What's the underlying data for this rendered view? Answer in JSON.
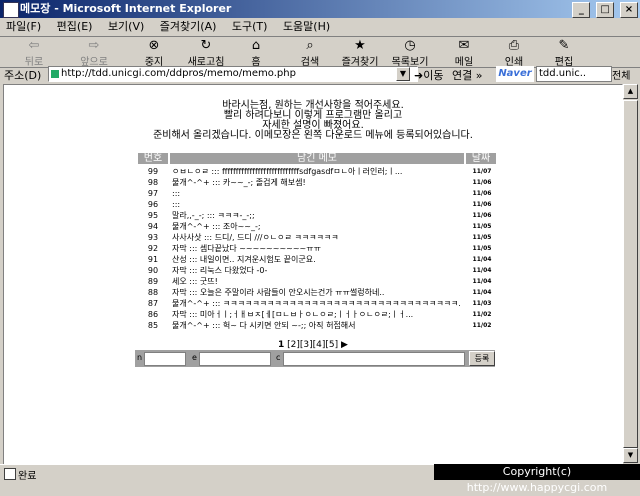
{
  "window": {
    "title": "메모장 - Microsoft Internet Explorer",
    "min_label": "_",
    "max_label": "□",
    "close_label": "×"
  },
  "menu": [
    "파일(F)",
    "편집(E)",
    "보기(V)",
    "즐겨찾기(A)",
    "도구(T)",
    "도움말(H)"
  ],
  "toolbar": {
    "back": "뒤로",
    "forward": "앞으로",
    "stop": "중지",
    "refresh": "새로고침",
    "home": "홈",
    "search": "검색",
    "favorites": "즐겨찾기",
    "history": "목록보기",
    "mail": "메일",
    "print": "인쇄",
    "edit": "편집"
  },
  "address": {
    "label": "주소(D)",
    "url": "http://tdd.unicgi.com/ddpros/memo/memo.php",
    "go": "이동",
    "links": "연결 »",
    "naver": "Naver",
    "naver_input": "tdd.unic..",
    "fullview": "전체"
  },
  "intro": [
    "바라시는점, 원하는 개선사항을 적어주세요.",
    "빨리 하려다보니 이렇게 프로그램만 올리고",
    "자세한 설명이 빠졌어요.",
    "준비해서 올리겠습니다. 이메모장은 왼쪽 다운로드 메뉴에 등록되어있습니다."
  ],
  "table": {
    "headers": [
      "번호",
      "남긴 메모",
      "날짜"
    ],
    "rows": [
      {
        "num": "99",
        "msg": "ㅇㅂㄴㅇㄹ ::: ffffffffffffffffffffffffffffsdfgasdfㅁㄴ아ㅣ러인러;ㅣ...",
        "date": "11/07"
      },
      {
        "num": "98",
        "msg": "물개^-^+ ::: 카~~_-; 졸겁게 해보셈!",
        "date": "11/06"
      },
      {
        "num": "97",
        "msg": ":::",
        "date": "11/06"
      },
      {
        "num": "96",
        "msg": ":::",
        "date": "11/06"
      },
      {
        "num": "95",
        "msg": "말라,,-_-; ::: ㅋㅋㅋ-_-;;",
        "date": "11/06"
      },
      {
        "num": "94",
        "msg": "물개^-^+ ::: 조아~~_-;",
        "date": "11/05"
      },
      {
        "num": "93",
        "msg": "사사사삿 ::: 드디/, 드디 ///ㅇㄴㅇㄹ ㅋㅋㅋㅋㅋㅋ",
        "date": "11/05"
      },
      {
        "num": "92",
        "msg": "자막 ::: 셈다끝났다 ~~~~~~~~~~ㅠㅠ",
        "date": "11/05"
      },
      {
        "num": "91",
        "msg": "산성 ::: 내일이면.. 지겨운시험도 끝이군요.",
        "date": "11/04"
      },
      {
        "num": "90",
        "msg": "자막 ::: 리눅스 다왔었다 -0-",
        "date": "11/04"
      },
      {
        "num": "89",
        "msg": "세오 ::: 굿뜨!",
        "date": "11/04"
      },
      {
        "num": "88",
        "msg": "자막 ::: 오늘은 주말이라 사람들이 안오시는건가 ㅠㅠ썰렁하네..",
        "date": "11/04"
      },
      {
        "num": "87",
        "msg": "물개^-^+ ::: ㅋㅋㅋㅋㅋㅋㅋㅋㅋㅋㅋㅋㅋㅋㅋㅋㅋㅋㅋㅋㅋㅋㅋㅋㅋㅋㅋㅋㅋㅋㅋㅋ..",
        "date": "11/03"
      },
      {
        "num": "86",
        "msg": "자막 ::: 미아ㅓㅣ;ㅓㅐㅂㅈ[ㅔ[ㅁㄴㅂㅏㅇㄴㅇㄹ;ㅣㅓㅏㅇㄴㅇㄹ;ㅣㅓ...",
        "date": "11/02"
      },
      {
        "num": "85",
        "msg": "물개^-^+ ::: 헉~ 다 시키면 안되 ~-;; 아직 허접해서",
        "date": "11/02"
      }
    ]
  },
  "pager": {
    "pages": [
      "1",
      "[2]",
      "[3]",
      "[4]",
      "[5]"
    ],
    "next": "▶"
  },
  "form": {
    "name_label": "n",
    "email_label": "e",
    "content_label": "c",
    "submit": "등록"
  },
  "status": {
    "text": "완료",
    "copyright": "Copyright(c) http://www.happycgi.com"
  }
}
